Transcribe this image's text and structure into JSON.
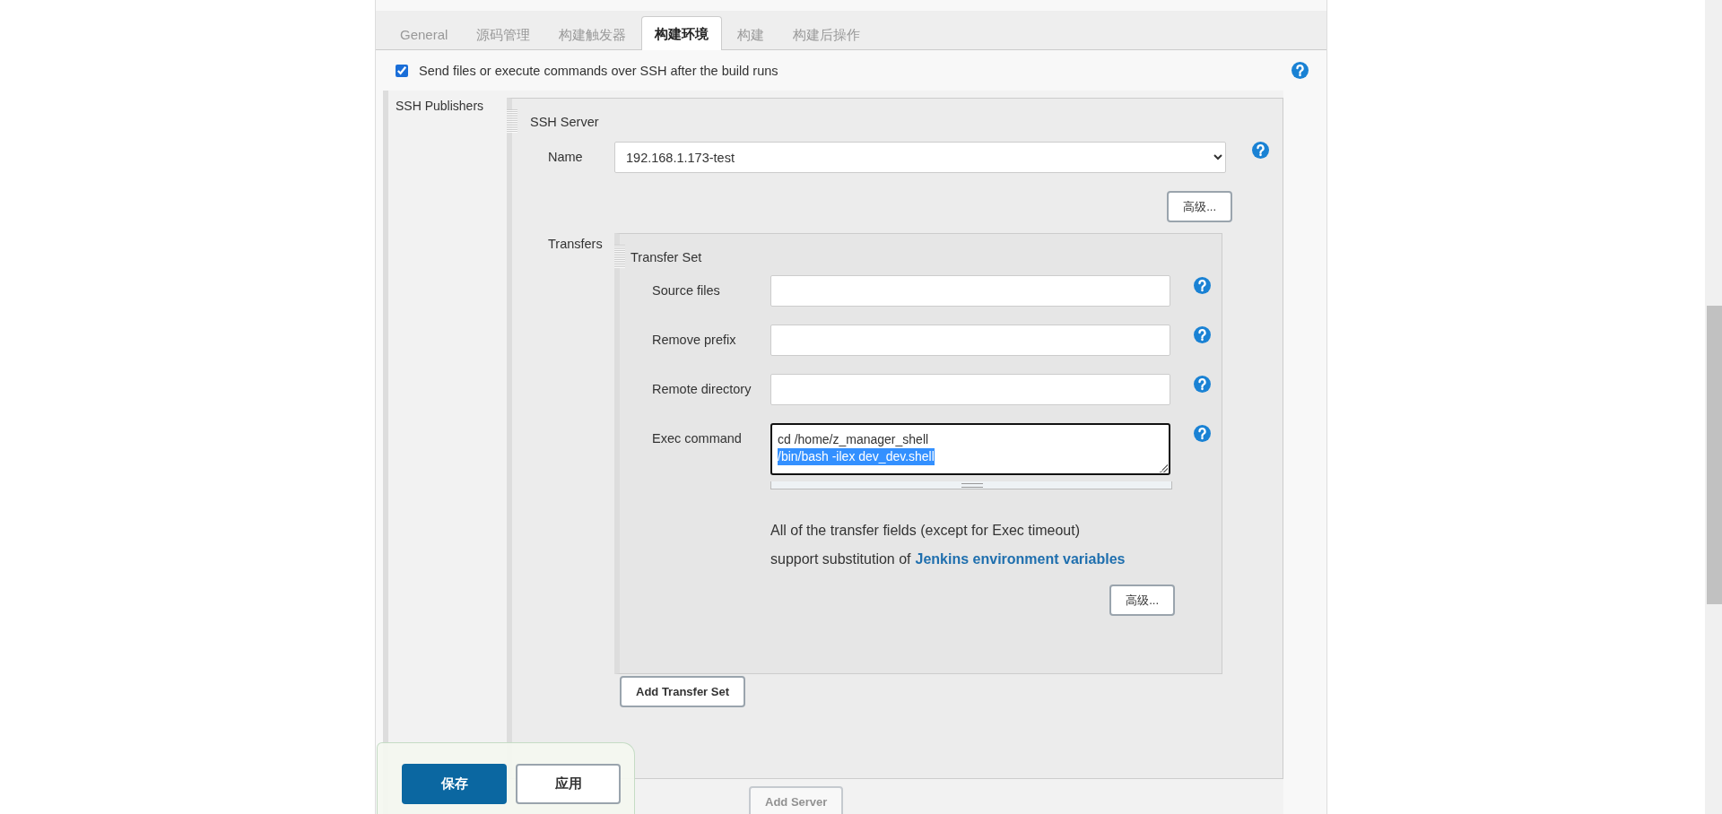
{
  "tabs": [
    {
      "label": "General",
      "selected": false
    },
    {
      "label": "源码管理",
      "selected": false
    },
    {
      "label": "构建触发器",
      "selected": false
    },
    {
      "label": "构建环境",
      "selected": true
    },
    {
      "label": "构建",
      "selected": false
    },
    {
      "label": "构建后操作",
      "selected": false
    }
  ],
  "ssh_option": {
    "label": "Send files or execute commands over SSH after the build runs",
    "checked": true
  },
  "ssh_publishers": {
    "label": "SSH Publishers",
    "server": {
      "title": "SSH Server",
      "name_label": "Name",
      "name_value": "192.168.1.173-test",
      "advanced_button": "高级...",
      "transfers_label": "Transfers",
      "transfer_set": {
        "title": "Transfer Set",
        "fields": [
          {
            "label": "Source files",
            "kind": "input"
          },
          {
            "label": "Remove prefix",
            "kind": "input"
          },
          {
            "label": "Remote directory",
            "kind": "input"
          },
          {
            "label": "Exec command",
            "kind": "textarea",
            "lines": [
              {
                "text": "cd  /home/z_manager_shell",
                "selected": false
              },
              {
                "text": "/bin/bash  -ilex dev_dev.shell",
                "selected": true
              }
            ]
          }
        ],
        "note": {
          "lines": [
            "All of the transfer fields (except for Exec timeout)",
            "support substitution of"
          ],
          "link": "Jenkins environment variables"
        },
        "advanced_button": "高级..."
      },
      "add_transfer_set_button": "Add Transfer Set"
    },
    "add_server_button": "Add Server"
  },
  "bottom_bar": {
    "buttons": [
      {
        "label": "保存",
        "kind": "primary"
      },
      {
        "label": "应用",
        "kind": "secondary"
      }
    ]
  }
}
